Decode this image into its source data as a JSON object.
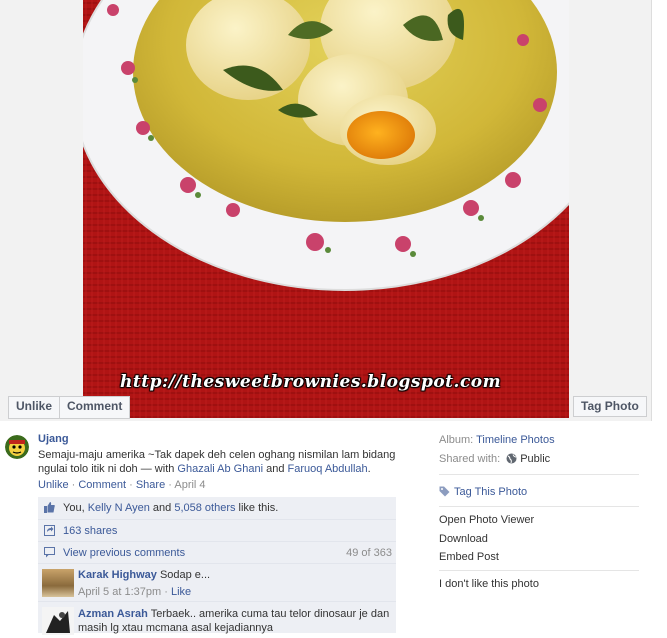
{
  "photo": {
    "watermark": "http://thesweetbrownies.blogspot.com",
    "actions": {
      "unlike": "Unlike",
      "comment": "Comment",
      "tag_photo": "Tag Photo"
    }
  },
  "post": {
    "author": "Ujang",
    "caption_text": "Semaju-maju amerika ~Tak dapek deh celen oghang nismilan lam bidang ngulai tolo itik ni doh",
    "with_prefix": " — with ",
    "tagged_1": "Ghazali Ab Ghani",
    "and": " and ",
    "tagged_2": "Faruoq Abdullah",
    "end": ".",
    "actions": {
      "unlike": "Unlike",
      "sep": " · ",
      "comment": "Comment",
      "share": "Share",
      "date": "April 4"
    }
  },
  "ufi": {
    "likes": {
      "you": "You, ",
      "person": "Kelly N Ayen",
      "and": " and ",
      "others": "5,058 others",
      "tail": " like this."
    },
    "shares": "163 shares",
    "view_previous": "View previous comments",
    "count": "49 of 363",
    "comments": [
      {
        "name": "Karak Highway",
        "text": "Sodap e...",
        "date": "April 5 at 1:37pm",
        "like": "Like"
      },
      {
        "name": "Azman Asrah",
        "text": "Terbaek.. amerika cuma tau telor dinosaur je dan masih lg xtau mcmana asal kejadiannya"
      }
    ]
  },
  "sidebar": {
    "album_label": "Album:",
    "album_value": "Timeline Photos",
    "shared_label": "Shared with:",
    "shared_value": "Public",
    "tag_this_photo": "Tag This Photo",
    "links": [
      "Open Photo Viewer",
      "Download",
      "Embed Post"
    ],
    "dislike": "I don't like this photo"
  },
  "colors": {
    "link": "#3b5998",
    "ufi_bg": "#edeff4",
    "tablecloth": "#b21212",
    "curry": "#d8c13a"
  }
}
